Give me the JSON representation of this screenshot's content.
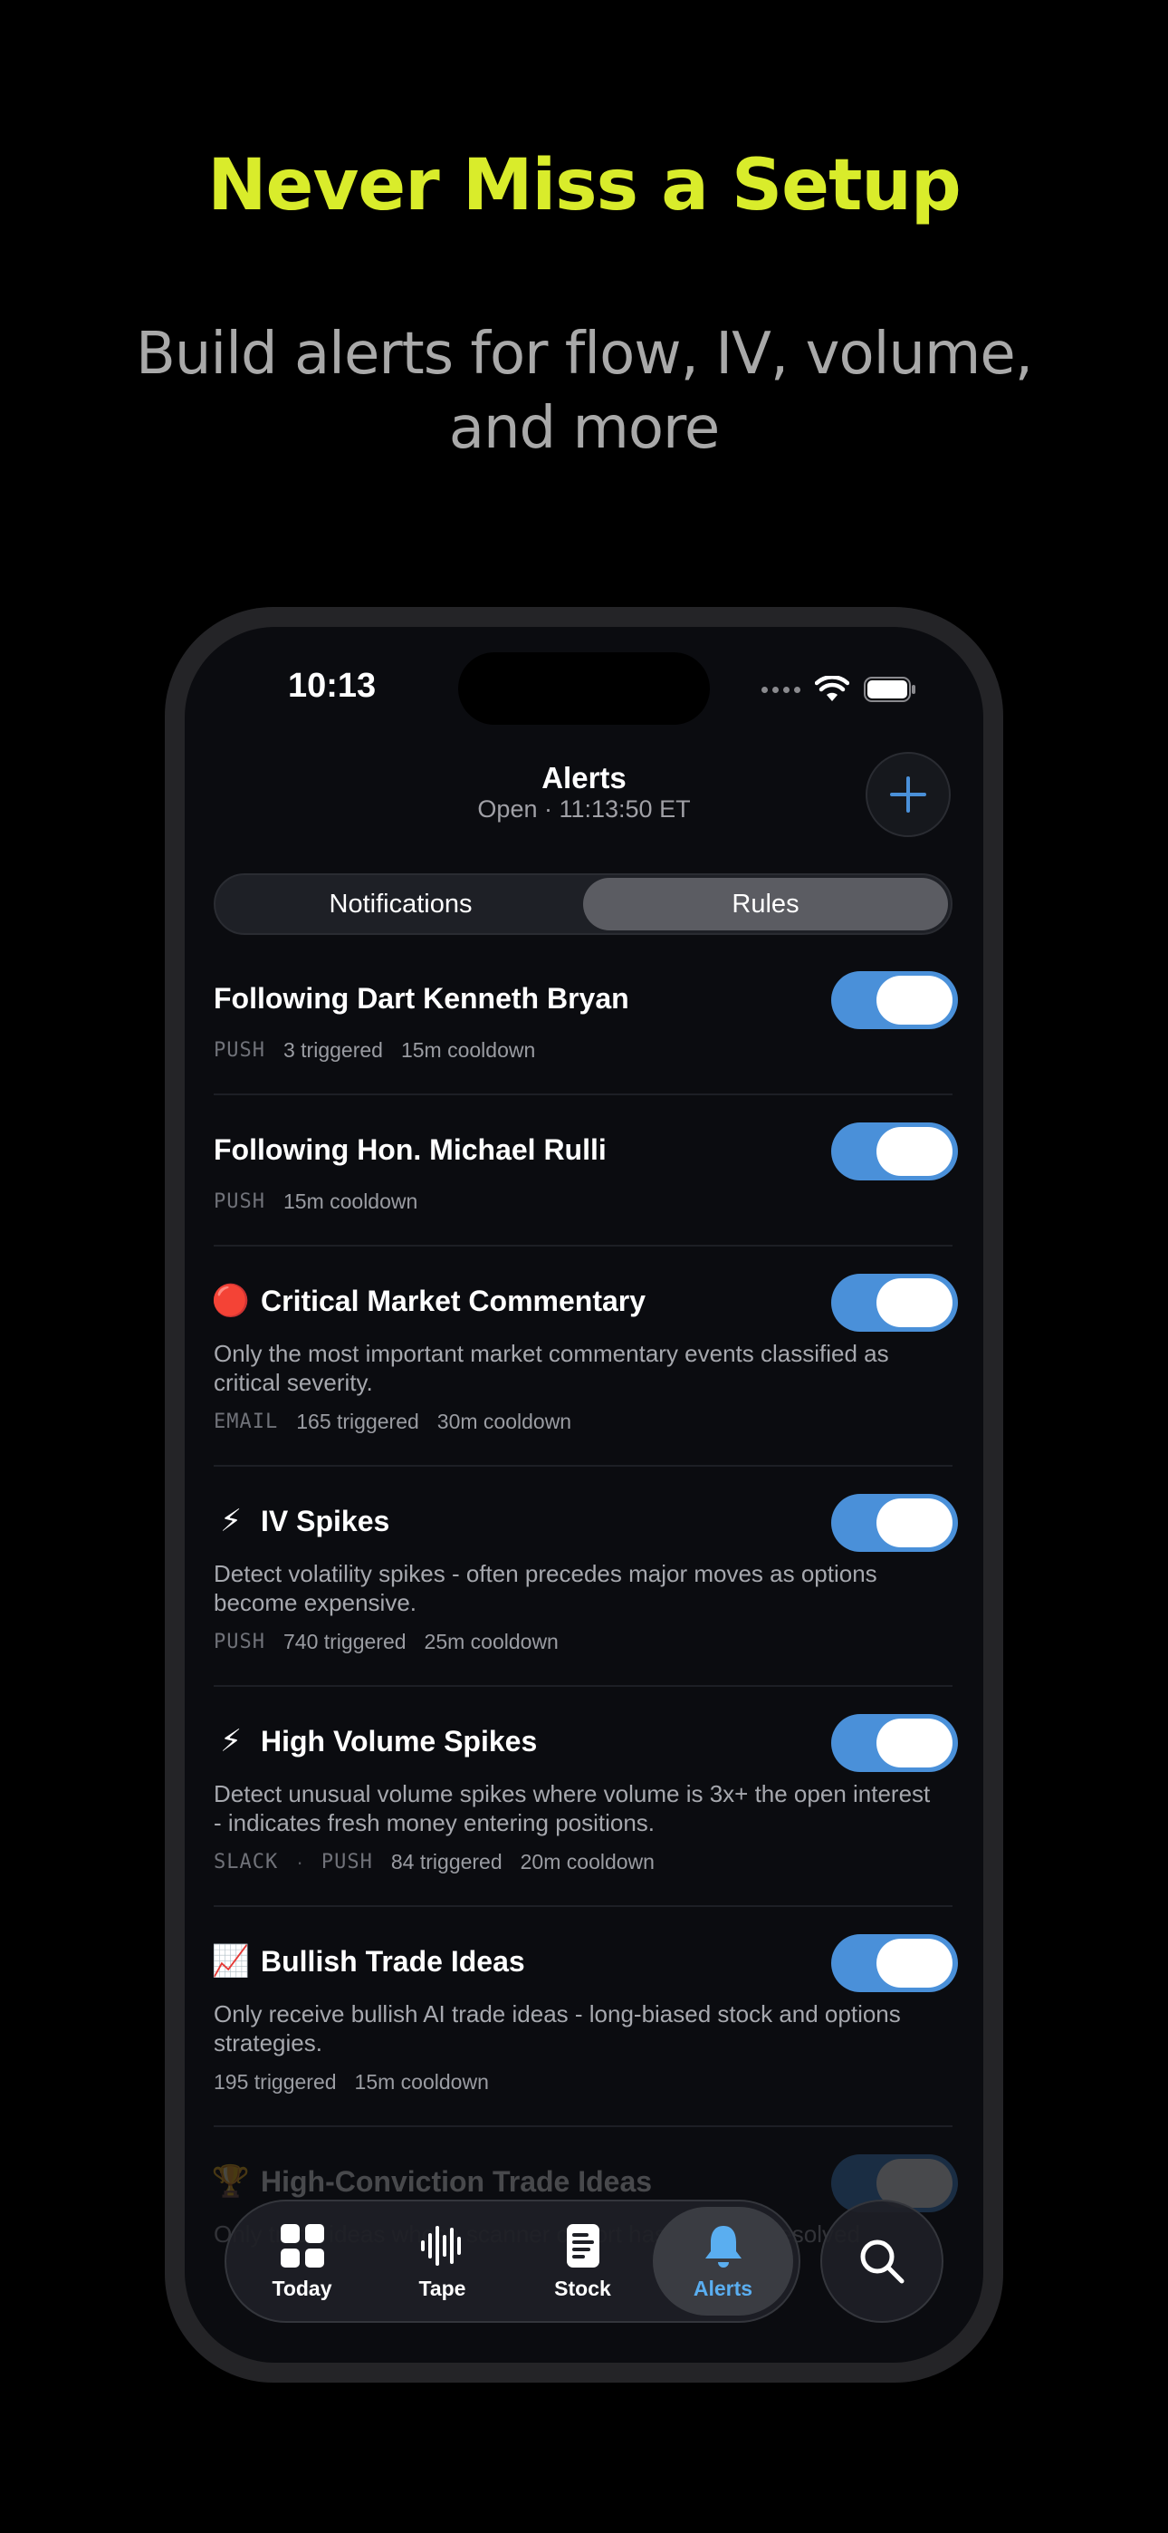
{
  "headline": "Never Miss a Setup",
  "subheadline": "Build alerts for flow, IV, volume, and more",
  "status_bar": {
    "time": "10:13"
  },
  "nav": {
    "title": "Alerts",
    "subtitle": "Open · 11:13:50 ET"
  },
  "segments": [
    "Notifications",
    "Rules"
  ],
  "active_segment": "Rules",
  "accent_color": "#4a90d9",
  "headline_color": "#d9ec2b",
  "rules": [
    {
      "title": "Following Dart Kenneth Bryan",
      "emoji": "",
      "description": "",
      "channels": "PUSH",
      "triggered": "3 triggered",
      "cooldown": "15m cooldown",
      "enabled": true
    },
    {
      "title": "Following Hon. Michael Rulli",
      "emoji": "",
      "description": "",
      "channels": "PUSH",
      "triggered": "",
      "cooldown": "15m cooldown",
      "enabled": true
    },
    {
      "title": "Critical Market Commentary",
      "emoji": "🔴",
      "description": "Only the most important market commentary events classified as critical severity.",
      "channels": "EMAIL",
      "triggered": "165 triggered",
      "cooldown": "30m cooldown",
      "enabled": true
    },
    {
      "title": "IV Spikes",
      "emoji": "⚡",
      "description": "Detect volatility spikes - often precedes major moves as options become expensive.",
      "channels": "PUSH",
      "triggered": "740 triggered",
      "cooldown": "25m cooldown",
      "enabled": true
    },
    {
      "title": "High Volume Spikes",
      "emoji": "⚡",
      "description": "Detect unusual volume spikes where volume is 3x+ the open interest - indicates fresh money entering positions.",
      "channels": "SLACK",
      "channels2": "PUSH",
      "triggered": "84 triggered",
      "cooldown": "20m cooldown",
      "enabled": true
    },
    {
      "title": "Bullish Trade Ideas",
      "emoji": "📈",
      "description": "Only receive bullish AI trade ideas - long-biased stock and options strategies.",
      "channels": "",
      "triggered": "195 triggered",
      "cooldown": "15m cooldown",
      "enabled": true
    },
    {
      "title": "High-Conviction Trade Ideas",
      "emoji": "🏆",
      "description": "Only trade ideas whose scanner cohort has a proven resolved",
      "channels": "",
      "triggered": "",
      "cooldown": "",
      "enabled": true
    }
  ],
  "tabbar": {
    "tabs": [
      {
        "label": "Today",
        "icon": "grid-icon"
      },
      {
        "label": "Tape",
        "icon": "waveform-icon"
      },
      {
        "label": "Stock",
        "icon": "document-icon"
      },
      {
        "label": "Alerts",
        "icon": "bell-icon"
      }
    ],
    "active": "Alerts"
  }
}
